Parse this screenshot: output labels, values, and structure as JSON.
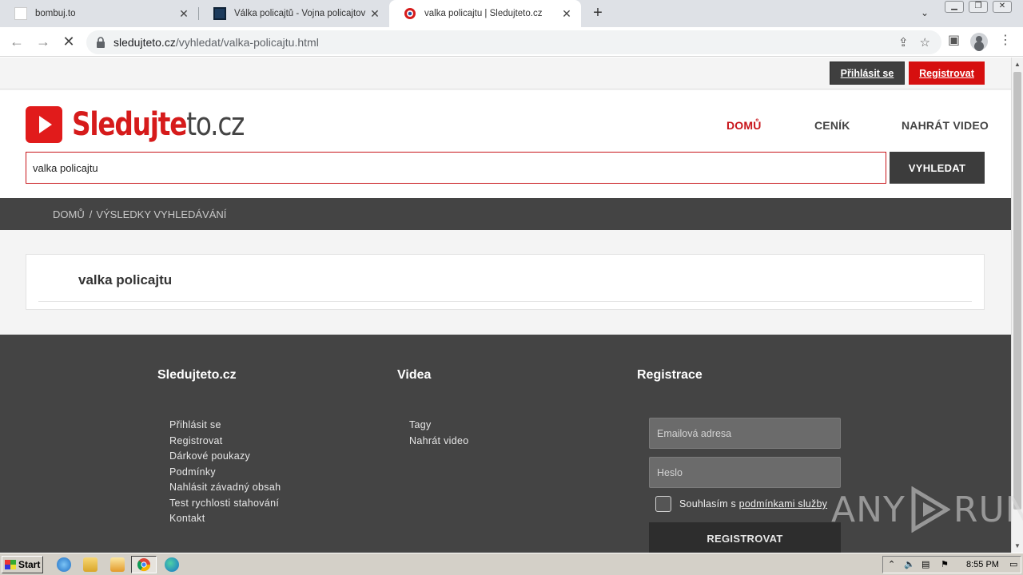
{
  "browser": {
    "tabs": [
      {
        "title": "bombuj.to"
      },
      {
        "title": "Válka policajtů - Vojna policajtov online"
      },
      {
        "title": "valka policajtu | Sledujteto.cz"
      }
    ],
    "new_tab_glyph": "+",
    "url_host": "sledujteto.cz",
    "url_path": "/vyhledat/valka-policajtu.html"
  },
  "site": {
    "logo_part1": "Sledujte",
    "logo_part2": "to.cz",
    "top_buttons": {
      "login": "Přihlásit se",
      "register": "Registrovat"
    },
    "nav": [
      {
        "label": "DOMŮ"
      },
      {
        "label": "CENÍK"
      },
      {
        "label": "NAHRÁT VIDEO"
      }
    ],
    "search": {
      "value": "valka policajtu",
      "button": "VYHLEDAT"
    },
    "breadcrumb": {
      "home": "DOMŮ",
      "separator": "/",
      "current": "VÝSLEDKY VYHLEDÁVÁNÍ"
    },
    "results_title": "valka policajtu",
    "accent_color": "#d60f0f"
  },
  "footer": {
    "col1": {
      "title": "Sledujteto.cz",
      "links": [
        "Přihlásit se",
        "Registrovat",
        "Dárkové poukazy",
        "Podmínky",
        "Nahlásit závadný obsah",
        "Test rychlosti stahování",
        "Kontakt"
      ]
    },
    "col2": {
      "title": "Videa",
      "links": [
        "Tagy",
        "Nahrát video"
      ]
    },
    "col3": {
      "title": "Registrace",
      "email_placeholder": "Emailová adresa",
      "password_placeholder": "Heslo",
      "agree_prefix": "Souhlasím s",
      "agree_link": "podmínkami služby",
      "register_button": "REGISTROVAT"
    }
  },
  "watermark": {
    "left": "ANY",
    "right": "RUN"
  },
  "taskbar": {
    "start_label": "Start",
    "clock": "8:55 PM"
  }
}
